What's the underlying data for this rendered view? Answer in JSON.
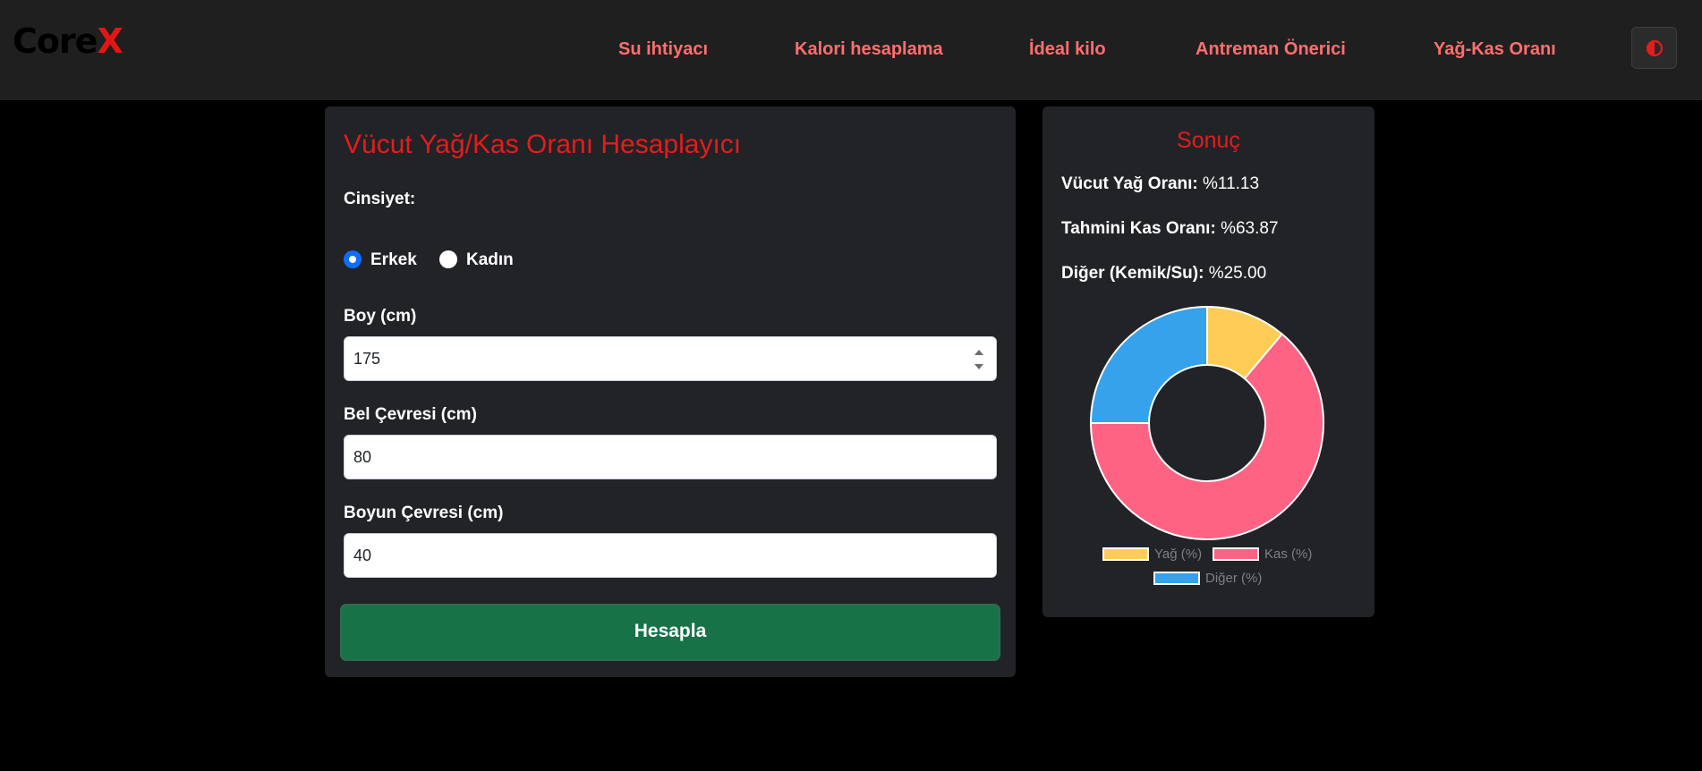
{
  "brand": {
    "main": "Core",
    "accent": "X"
  },
  "nav": {
    "links": [
      "Su ihtiyacı",
      "Kalori hesaplama",
      "İdeal kilo",
      "Antreman Önerici",
      "Yağ-Kas Oranı"
    ],
    "theme_toggle_icon": "contrast-icon"
  },
  "form": {
    "title": "Vücut Yağ/Kas Oranı Hesaplayıcı",
    "gender_label": "Cinsiyet:",
    "gender_options": [
      "Erkek",
      "Kadın"
    ],
    "gender_selected": "Erkek",
    "height_label": "Boy (cm)",
    "height_value": "175",
    "waist_label": "Bel Çevresi (cm)",
    "waist_value": "80",
    "neck_label": "Boyun Çevresi (cm)",
    "neck_value": "40",
    "submit_label": "Hesapla"
  },
  "result": {
    "title": "Sonuç",
    "fat_label": "Vücut Yağ Oranı:",
    "fat_value": "%11.13",
    "muscle_label": "Tahmini Kas Oranı:",
    "muscle_value": "%63.87",
    "other_label": "Diğer (Kemik/Su):",
    "other_value": "%25.00"
  },
  "chart_data": {
    "type": "pie",
    "variant": "doughnut",
    "categories": [
      "Yağ (%)",
      "Kas (%)",
      "Diğer (%)"
    ],
    "values": [
      11.13,
      63.87,
      25.0
    ],
    "colors": [
      "#ffcd56",
      "#ff6384",
      "#36a2eb"
    ],
    "legend_position": "bottom"
  },
  "colors": {
    "accent_red": "#e41c1c",
    "nav_link": "#ff6f6f",
    "submit_green": "#187248",
    "radio_checked": "#0d6efd"
  }
}
